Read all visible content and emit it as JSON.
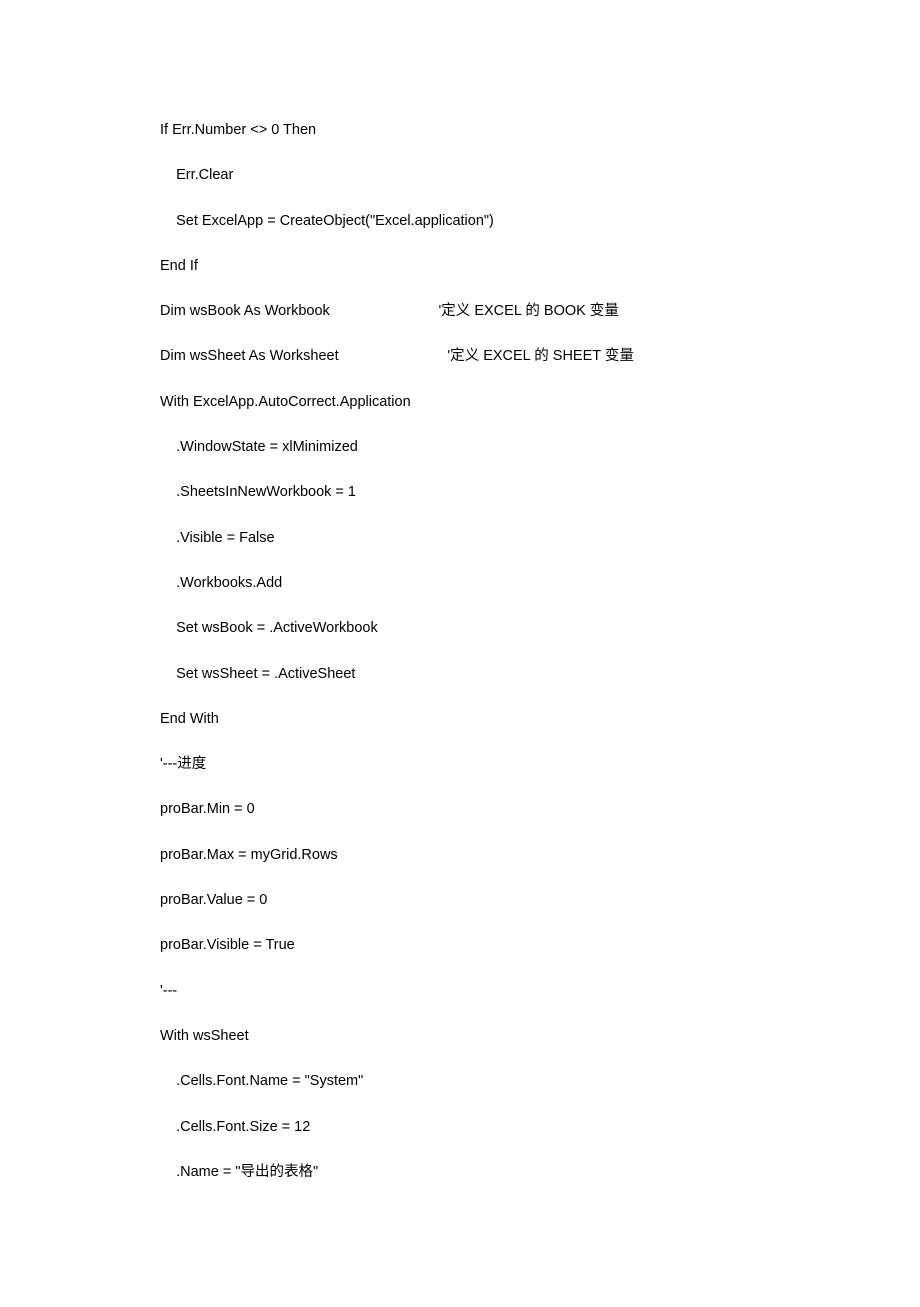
{
  "code_lines": [
    {
      "indent": 0,
      "text": "If Err.Number <> 0 Then"
    },
    {
      "indent": 1,
      "text": "Err.Clear"
    },
    {
      "indent": 1,
      "text": "Set ExcelApp = CreateObject(\"Excel.application\")"
    },
    {
      "indent": 0,
      "text": "End If"
    },
    {
      "indent": 0,
      "text": "Dim wsBook As Workbook                           '定义 EXCEL 的 BOOK 变量"
    },
    {
      "indent": 0,
      "text": "Dim wsSheet As Worksheet                           '定义 EXCEL 的 SHEET 变量"
    },
    {
      "indent": 0,
      "text": "With ExcelApp.AutoCorrect.Application"
    },
    {
      "indent": 1,
      "text": ".WindowState = xlMinimized"
    },
    {
      "indent": 1,
      "text": ".SheetsInNewWorkbook = 1"
    },
    {
      "indent": 1,
      "text": ".Visible = False"
    },
    {
      "indent": 1,
      "text": ".Workbooks.Add"
    },
    {
      "indent": 1,
      "text": "Set wsBook = .ActiveWorkbook"
    },
    {
      "indent": 1,
      "text": "Set wsSheet = .ActiveSheet"
    },
    {
      "indent": 0,
      "text": "End With"
    },
    {
      "indent": 0,
      "text": "'---进度"
    },
    {
      "indent": 0,
      "text": "proBar.Min = 0"
    },
    {
      "indent": 0,
      "text": "proBar.Max = myGrid.Rows"
    },
    {
      "indent": 0,
      "text": "proBar.Value = 0"
    },
    {
      "indent": 0,
      "text": "proBar.Visible = True"
    },
    {
      "indent": 0,
      "text": "'---"
    },
    {
      "indent": 0,
      "text": "With wsSheet"
    },
    {
      "indent": 1,
      "text": ".Cells.Font.Name = \"System\""
    },
    {
      "indent": 1,
      "text": ".Cells.Font.Size = 12"
    },
    {
      "indent": 1,
      "text": ".Name = \"导出的表格\""
    }
  ]
}
